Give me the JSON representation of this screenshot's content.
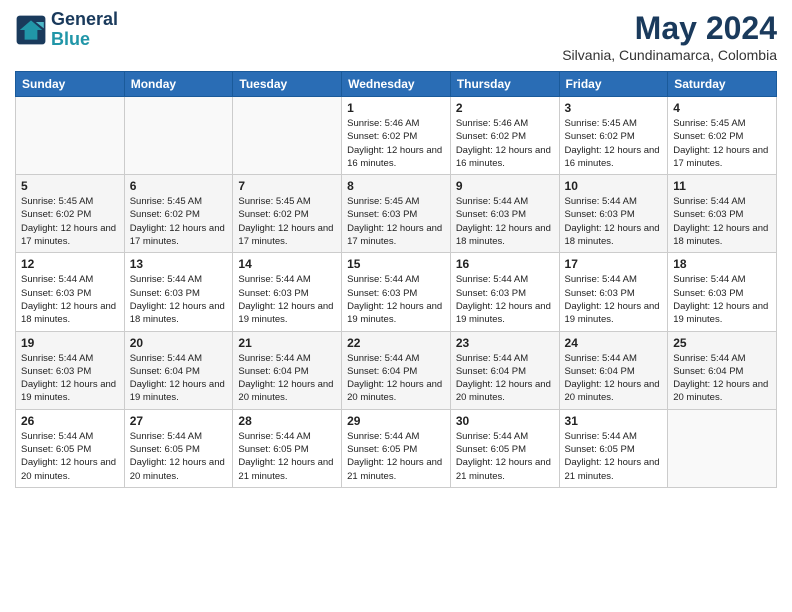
{
  "header": {
    "logo_line1": "General",
    "logo_line2": "Blue",
    "month_year": "May 2024",
    "location": "Silvania, Cundinamarca, Colombia"
  },
  "weekdays": [
    "Sunday",
    "Monday",
    "Tuesday",
    "Wednesday",
    "Thursday",
    "Friday",
    "Saturday"
  ],
  "weeks": [
    [
      {
        "day": "",
        "sunrise": "",
        "sunset": "",
        "daylight": ""
      },
      {
        "day": "",
        "sunrise": "",
        "sunset": "",
        "daylight": ""
      },
      {
        "day": "",
        "sunrise": "",
        "sunset": "",
        "daylight": ""
      },
      {
        "day": "1",
        "sunrise": "Sunrise: 5:46 AM",
        "sunset": "Sunset: 6:02 PM",
        "daylight": "Daylight: 12 hours and 16 minutes."
      },
      {
        "day": "2",
        "sunrise": "Sunrise: 5:46 AM",
        "sunset": "Sunset: 6:02 PM",
        "daylight": "Daylight: 12 hours and 16 minutes."
      },
      {
        "day": "3",
        "sunrise": "Sunrise: 5:45 AM",
        "sunset": "Sunset: 6:02 PM",
        "daylight": "Daylight: 12 hours and 16 minutes."
      },
      {
        "day": "4",
        "sunrise": "Sunrise: 5:45 AM",
        "sunset": "Sunset: 6:02 PM",
        "daylight": "Daylight: 12 hours and 17 minutes."
      }
    ],
    [
      {
        "day": "5",
        "sunrise": "Sunrise: 5:45 AM",
        "sunset": "Sunset: 6:02 PM",
        "daylight": "Daylight: 12 hours and 17 minutes."
      },
      {
        "day": "6",
        "sunrise": "Sunrise: 5:45 AM",
        "sunset": "Sunset: 6:02 PM",
        "daylight": "Daylight: 12 hours and 17 minutes."
      },
      {
        "day": "7",
        "sunrise": "Sunrise: 5:45 AM",
        "sunset": "Sunset: 6:02 PM",
        "daylight": "Daylight: 12 hours and 17 minutes."
      },
      {
        "day": "8",
        "sunrise": "Sunrise: 5:45 AM",
        "sunset": "Sunset: 6:03 PM",
        "daylight": "Daylight: 12 hours and 17 minutes."
      },
      {
        "day": "9",
        "sunrise": "Sunrise: 5:44 AM",
        "sunset": "Sunset: 6:03 PM",
        "daylight": "Daylight: 12 hours and 18 minutes."
      },
      {
        "day": "10",
        "sunrise": "Sunrise: 5:44 AM",
        "sunset": "Sunset: 6:03 PM",
        "daylight": "Daylight: 12 hours and 18 minutes."
      },
      {
        "day": "11",
        "sunrise": "Sunrise: 5:44 AM",
        "sunset": "Sunset: 6:03 PM",
        "daylight": "Daylight: 12 hours and 18 minutes."
      }
    ],
    [
      {
        "day": "12",
        "sunrise": "Sunrise: 5:44 AM",
        "sunset": "Sunset: 6:03 PM",
        "daylight": "Daylight: 12 hours and 18 minutes."
      },
      {
        "day": "13",
        "sunrise": "Sunrise: 5:44 AM",
        "sunset": "Sunset: 6:03 PM",
        "daylight": "Daylight: 12 hours and 18 minutes."
      },
      {
        "day": "14",
        "sunrise": "Sunrise: 5:44 AM",
        "sunset": "Sunset: 6:03 PM",
        "daylight": "Daylight: 12 hours and 19 minutes."
      },
      {
        "day": "15",
        "sunrise": "Sunrise: 5:44 AM",
        "sunset": "Sunset: 6:03 PM",
        "daylight": "Daylight: 12 hours and 19 minutes."
      },
      {
        "day": "16",
        "sunrise": "Sunrise: 5:44 AM",
        "sunset": "Sunset: 6:03 PM",
        "daylight": "Daylight: 12 hours and 19 minutes."
      },
      {
        "day": "17",
        "sunrise": "Sunrise: 5:44 AM",
        "sunset": "Sunset: 6:03 PM",
        "daylight": "Daylight: 12 hours and 19 minutes."
      },
      {
        "day": "18",
        "sunrise": "Sunrise: 5:44 AM",
        "sunset": "Sunset: 6:03 PM",
        "daylight": "Daylight: 12 hours and 19 minutes."
      }
    ],
    [
      {
        "day": "19",
        "sunrise": "Sunrise: 5:44 AM",
        "sunset": "Sunset: 6:03 PM",
        "daylight": "Daylight: 12 hours and 19 minutes."
      },
      {
        "day": "20",
        "sunrise": "Sunrise: 5:44 AM",
        "sunset": "Sunset: 6:04 PM",
        "daylight": "Daylight: 12 hours and 19 minutes."
      },
      {
        "day": "21",
        "sunrise": "Sunrise: 5:44 AM",
        "sunset": "Sunset: 6:04 PM",
        "daylight": "Daylight: 12 hours and 20 minutes."
      },
      {
        "day": "22",
        "sunrise": "Sunrise: 5:44 AM",
        "sunset": "Sunset: 6:04 PM",
        "daylight": "Daylight: 12 hours and 20 minutes."
      },
      {
        "day": "23",
        "sunrise": "Sunrise: 5:44 AM",
        "sunset": "Sunset: 6:04 PM",
        "daylight": "Daylight: 12 hours and 20 minutes."
      },
      {
        "day": "24",
        "sunrise": "Sunrise: 5:44 AM",
        "sunset": "Sunset: 6:04 PM",
        "daylight": "Daylight: 12 hours and 20 minutes."
      },
      {
        "day": "25",
        "sunrise": "Sunrise: 5:44 AM",
        "sunset": "Sunset: 6:04 PM",
        "daylight": "Daylight: 12 hours and 20 minutes."
      }
    ],
    [
      {
        "day": "26",
        "sunrise": "Sunrise: 5:44 AM",
        "sunset": "Sunset: 6:05 PM",
        "daylight": "Daylight: 12 hours and 20 minutes."
      },
      {
        "day": "27",
        "sunrise": "Sunrise: 5:44 AM",
        "sunset": "Sunset: 6:05 PM",
        "daylight": "Daylight: 12 hours and 20 minutes."
      },
      {
        "day": "28",
        "sunrise": "Sunrise: 5:44 AM",
        "sunset": "Sunset: 6:05 PM",
        "daylight": "Daylight: 12 hours and 21 minutes."
      },
      {
        "day": "29",
        "sunrise": "Sunrise: 5:44 AM",
        "sunset": "Sunset: 6:05 PM",
        "daylight": "Daylight: 12 hours and 21 minutes."
      },
      {
        "day": "30",
        "sunrise": "Sunrise: 5:44 AM",
        "sunset": "Sunset: 6:05 PM",
        "daylight": "Daylight: 12 hours and 21 minutes."
      },
      {
        "day": "31",
        "sunrise": "Sunrise: 5:44 AM",
        "sunset": "Sunset: 6:05 PM",
        "daylight": "Daylight: 12 hours and 21 minutes."
      },
      {
        "day": "",
        "sunrise": "",
        "sunset": "",
        "daylight": ""
      }
    ]
  ]
}
